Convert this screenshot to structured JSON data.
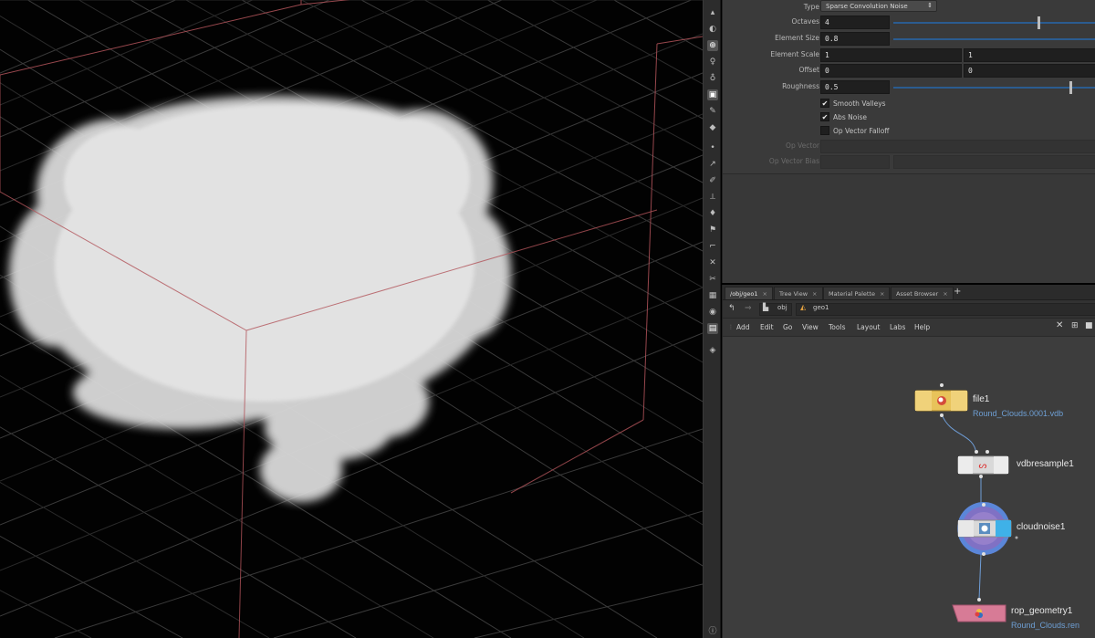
{
  "params": {
    "type_label": "Type",
    "type_value": "Sparse Convolution Noise",
    "octaves_label": "Octaves",
    "octaves_value": "4",
    "element_size_label": "Element Size",
    "element_size_value": "0.8",
    "element_scale_label": "Element Scale",
    "element_scale_x": "1",
    "element_scale_y": "1",
    "offset_label": "Offset",
    "offset_x": "0",
    "offset_y": "0",
    "roughness_label": "Roughness",
    "roughness_value": "0.5",
    "smooth_valleys_label": "Smooth Valleys",
    "abs_noise_label": "Abs Noise",
    "op_vector_falloff_label": "Op Vector Falloff",
    "op_vector_label": "Op Vector",
    "op_vector_bias_label": "Op Vector Bias",
    "checkmark": "✔"
  },
  "tabs": [
    {
      "label": "/obj/geo1"
    },
    {
      "label": "Tree View"
    },
    {
      "label": "Material Palette"
    },
    {
      "label": "Asset Browser"
    }
  ],
  "tab_close": "×",
  "tab_add": "+",
  "path": {
    "obj": "obj",
    "geo": "geo1"
  },
  "menus": [
    "Add",
    "Edit",
    "Go",
    "View",
    "Tools",
    "Layout",
    "Labs",
    "Help"
  ],
  "nodes": {
    "file1": {
      "name": "file1",
      "file": "Round_Clouds.0001.vdb"
    },
    "vdbresample1": {
      "name": "vdbresample1"
    },
    "cloudnoise1": {
      "name": "cloudnoise1"
    },
    "rop_geometry1": {
      "name": "rop_geometry1",
      "file": "Round_Clouds.ren"
    }
  },
  "colors": {
    "file_node": "#e8c35a",
    "rop_node": "#d77b96",
    "cloud_ring": "#5b86d8",
    "slider": "#2b5c90",
    "bbox": "#b2545a"
  },
  "sliders": {
    "octaves_fraction": 0.72,
    "element_size_fraction": 1.0,
    "roughness_fraction": 0.88
  }
}
